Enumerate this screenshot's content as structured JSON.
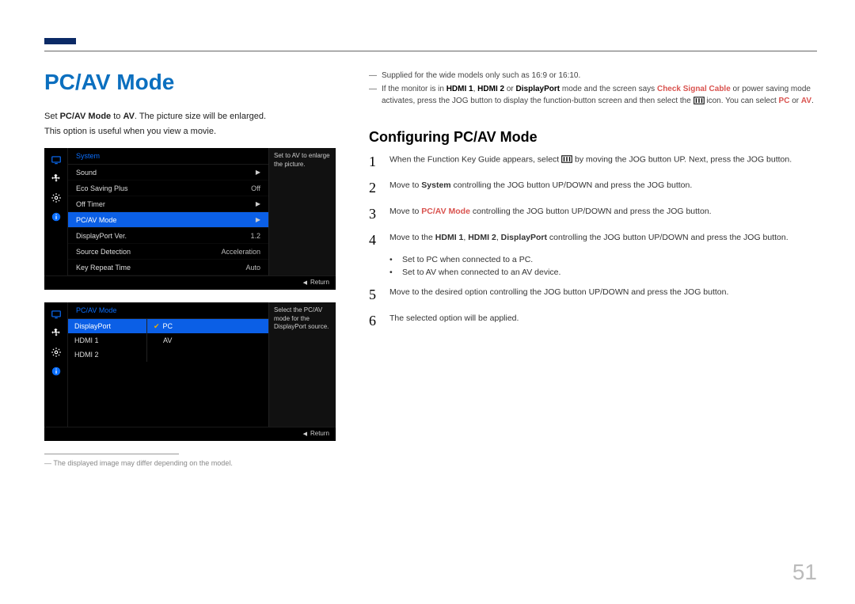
{
  "header": {
    "title": "PC/AV Mode"
  },
  "intro": {
    "line1_pre": "Set ",
    "line1_b1": "PC/AV Mode",
    "line1_mid": " to ",
    "line1_b2": "AV",
    "line1_post": ". The picture size will be enlarged.",
    "line2": "This option is useful when you view a movie."
  },
  "osd1": {
    "header": "System",
    "hint": "Set to AV to enlarge the picture.",
    "rows": [
      {
        "label": "Sound",
        "value": "",
        "arrow": true,
        "selected": false
      },
      {
        "label": "Eco Saving Plus",
        "value": "Off",
        "arrow": false,
        "selected": false
      },
      {
        "label": "Off Timer",
        "value": "",
        "arrow": true,
        "selected": false
      },
      {
        "label": "PC/AV Mode",
        "value": "",
        "arrow": true,
        "selected": true
      },
      {
        "label": "DisplayPort Ver.",
        "value": "1.2",
        "arrow": false,
        "selected": false
      },
      {
        "label": "Source Detection",
        "value": "Acceleration",
        "arrow": false,
        "selected": false
      },
      {
        "label": "Key Repeat Time",
        "value": "Auto",
        "arrow": false,
        "selected": false
      }
    ],
    "footer": "Return"
  },
  "osd2": {
    "header": "PC/AV Mode",
    "hint": "Select the PC/AV mode for the DisplayPort source.",
    "left_rows": [
      {
        "label": "DisplayPort",
        "selected": true
      },
      {
        "label": "HDMI 1",
        "selected": false
      },
      {
        "label": "HDMI 2",
        "selected": false
      }
    ],
    "right_rows": [
      {
        "label": "PC",
        "checked": true,
        "selected": true
      },
      {
        "label": "AV",
        "checked": false,
        "selected": false
      }
    ],
    "footer": "Return"
  },
  "left_footnote": {
    "dash": "―",
    "text": "The displayed image may differ depending on the model."
  },
  "right_notes": {
    "n1": {
      "dash": "―",
      "text": "Supplied for the wide models only such as 16:9 or 16:10."
    },
    "n2": {
      "dash": "―",
      "pre": "If the monitor is in ",
      "b1": "HDMI 1",
      "sep1": ", ",
      "b2": "HDMI 2",
      "sep2": " or ",
      "b3": "DisplayPort",
      "mid1": " mode and the screen says ",
      "r1": "Check Signal Cable",
      "mid2": " or power saving mode activates, press the JOG button to display the function-button screen and then select the ",
      "mid3": " icon. You can select ",
      "r2": "PC",
      "or": " or ",
      "r3": "AV",
      "end": "."
    }
  },
  "subtitle": "Configuring PC/AV Mode",
  "steps": {
    "s1": {
      "num": "1",
      "pre": "When the Function Key Guide appears, select ",
      "post": " by moving the JOG button UP. Next, press the JOG button."
    },
    "s2": {
      "num": "2",
      "pre": "Move to ",
      "b": "System",
      "post": " controlling the JOG button UP/DOWN and press the JOG button."
    },
    "s3": {
      "num": "3",
      "pre": "Move to ",
      "r": "PC/AV Mode",
      "post": " controlling the JOG button UP/DOWN and press the JOG button."
    },
    "s4": {
      "num": "4",
      "pre": "Move to the ",
      "b1": "HDMI 1",
      "sep1": ", ",
      "b2": "HDMI 2",
      "sep2": ", ",
      "b3": "DisplayPort",
      "post": " controlling the JOG button UP/DOWN and press the JOG button."
    },
    "sb1": {
      "dot": "•",
      "pre": "Set to ",
      "r": "PC",
      "post": " when connected to a PC."
    },
    "sb2": {
      "dot": "•",
      "pre": "Set to ",
      "r": "AV",
      "post": " when connected to an AV device."
    },
    "s5": {
      "num": "5",
      "text": "Move to the desired option controlling the JOG button UP/DOWN and press the JOG button."
    },
    "s6": {
      "num": "6",
      "text": "The selected option will be applied."
    }
  },
  "page_number": "51"
}
